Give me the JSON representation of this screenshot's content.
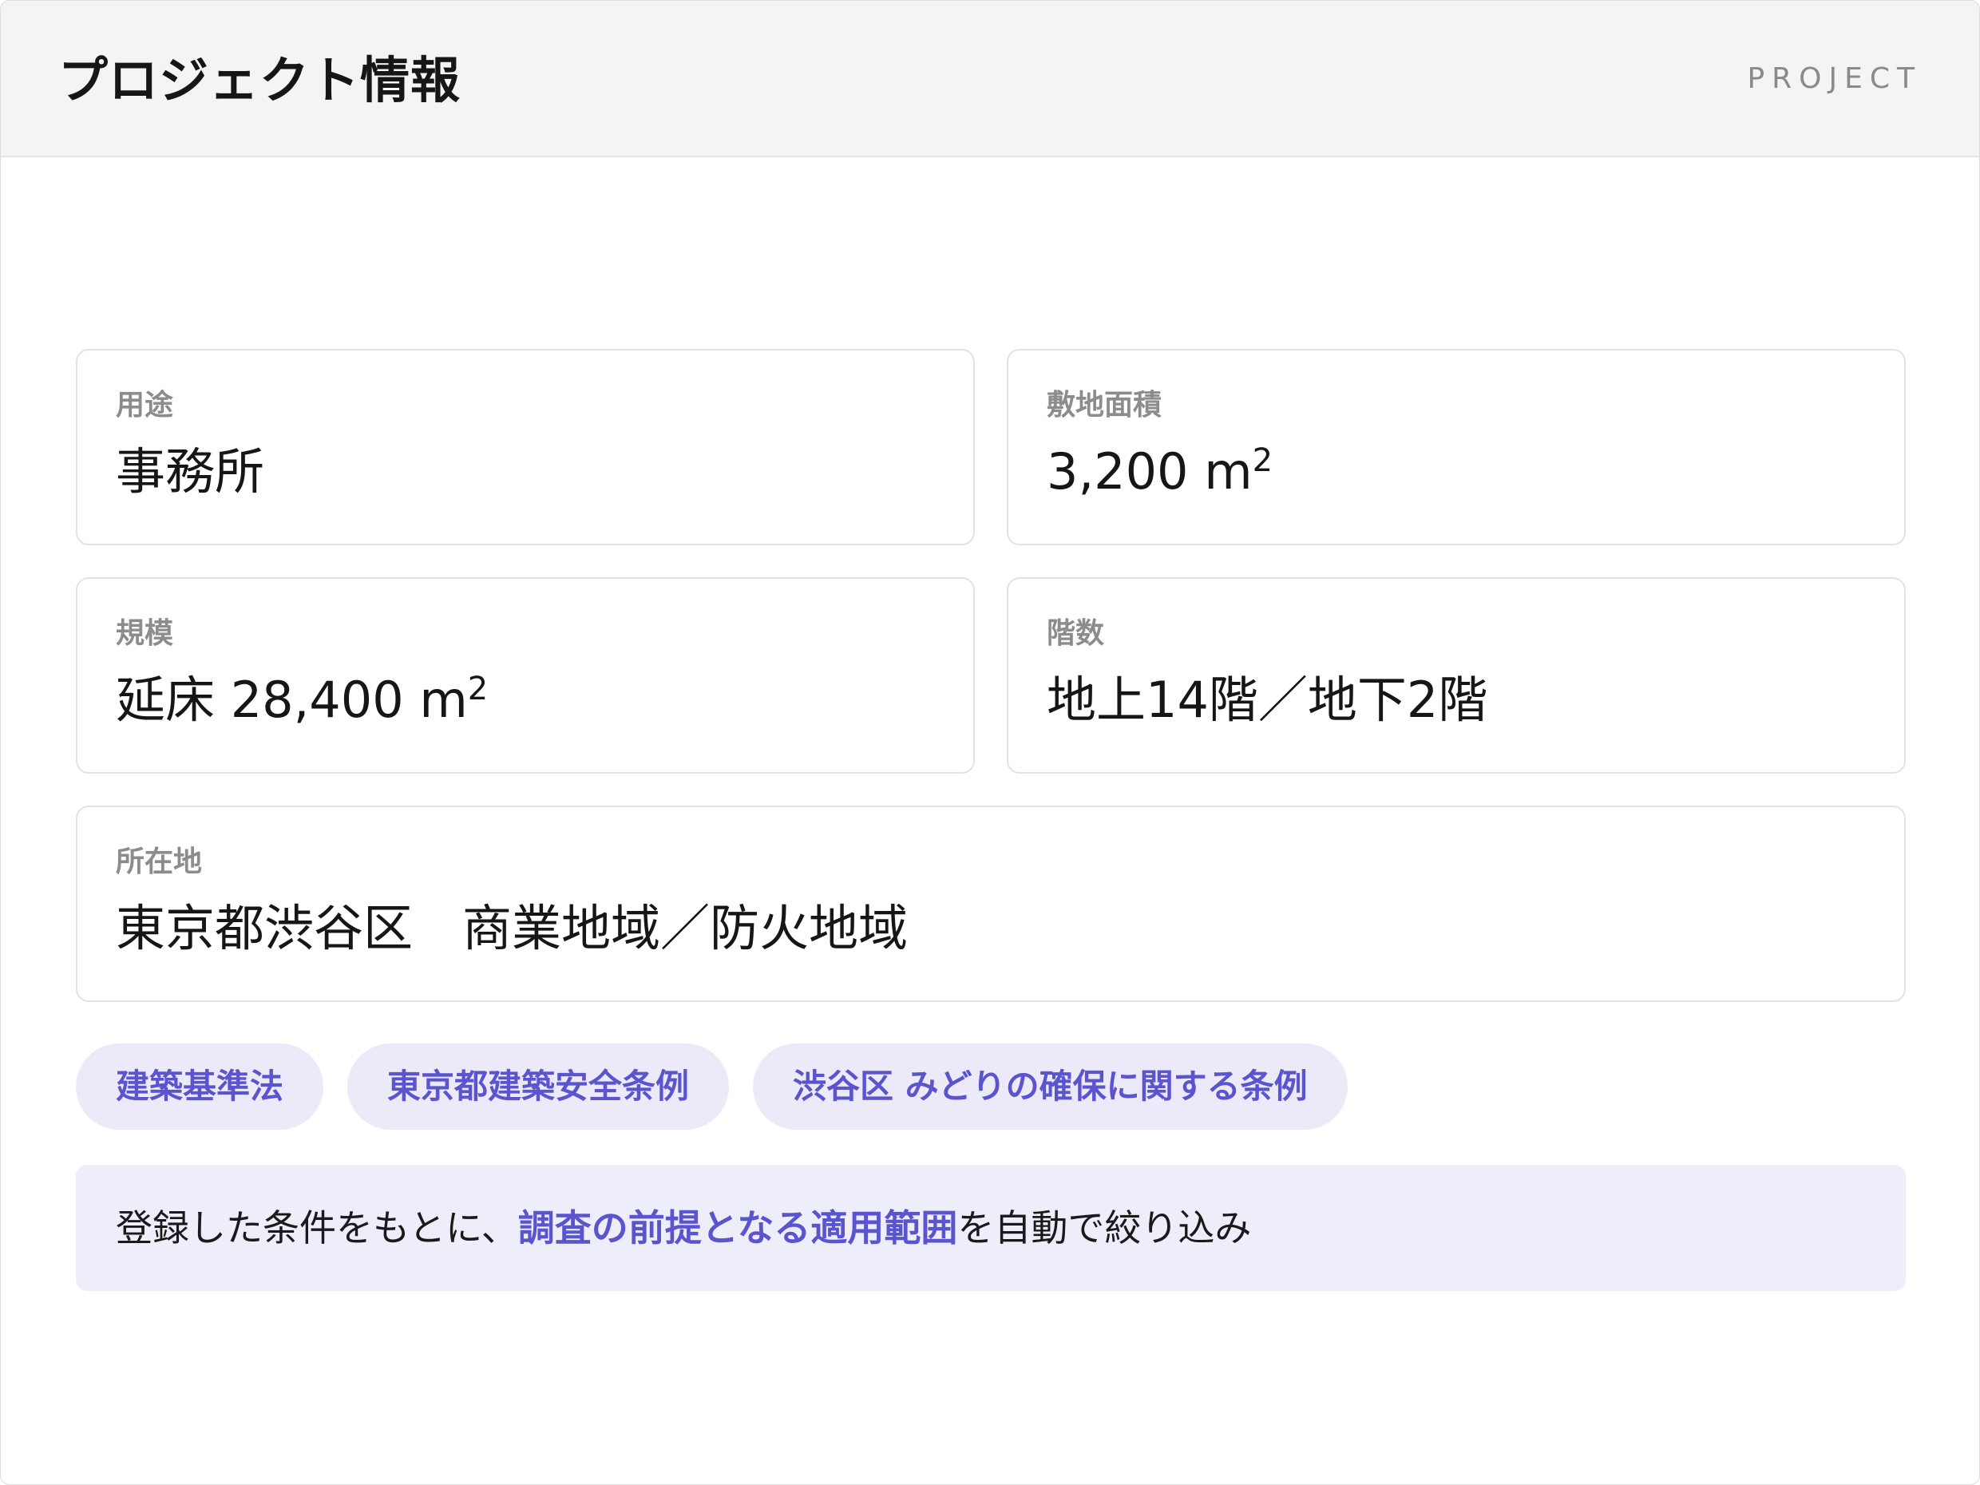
{
  "header": {
    "title": "プロジェクト情報",
    "tag": "PROJECT"
  },
  "cards": {
    "use": {
      "label": "用途",
      "value": "事務所"
    },
    "site": {
      "label": "敷地面積",
      "value": "3,200 m",
      "unit_sup": "2"
    },
    "scale": {
      "label": "規模",
      "value": "延床 28,400 m",
      "unit_sup": "2"
    },
    "floors": {
      "label": "階数",
      "value": "地上14階／地下2階"
    },
    "location": {
      "label": "所在地",
      "value": "東京都渋谷区　商業地域／防火地域"
    }
  },
  "regulations": [
    "建築基準法",
    "東京都建築安全条例",
    "渋谷区 みどりの確保に関する条例"
  ],
  "note": {
    "prefix": "登録した条件をもとに、",
    "highlight": "調査の前提となる適用範囲",
    "suffix": "を自動で絞り込み"
  },
  "colors": {
    "accent": "#5a55cf",
    "chip_bg": "#eceaf9",
    "note_bg": "#eeeefb",
    "header_bg": "#f4f4f4"
  }
}
